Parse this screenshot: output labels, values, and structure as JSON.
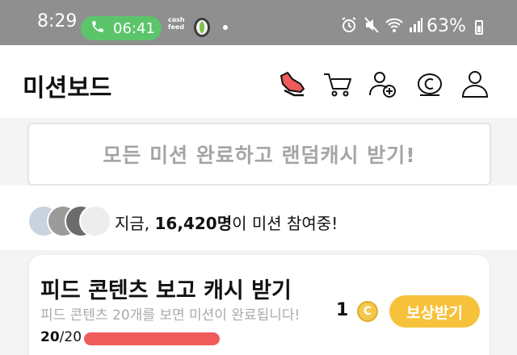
{
  "status_bar": {
    "time": "8:29",
    "call_duration": "06:41",
    "cashfeed_logo": "cash feed",
    "battery_percent": "63%"
  },
  "header": {
    "title": "미션보드",
    "icons": [
      "shoe-icon",
      "cart-icon",
      "add-friend-icon",
      "coin-c-icon",
      "profile-icon"
    ]
  },
  "banner": {
    "text": "모든 미션 완료하고 랜덤캐시 받기!"
  },
  "participants": {
    "prefix": "지금, ",
    "count": "16,420명",
    "suffix": "이 미션 참여중!"
  },
  "mission": {
    "title": "피드 콘텐츠 보고 캐시 받기",
    "description": "피드 콘텐츠 20개를 보면 미션이 완료됩니다!",
    "reward": "1",
    "coin_symbol": "C",
    "claim_label": "보상받기",
    "progress_done": "20",
    "progress_total": "/20",
    "progress_fraction": 1.0
  },
  "colors": {
    "status_bar": "#8f8f8f",
    "call_pill": "#5cc56b",
    "claim_button": "#f7c23b",
    "progress": "#ef5a5a",
    "banner_text": "#a5a5a5"
  }
}
